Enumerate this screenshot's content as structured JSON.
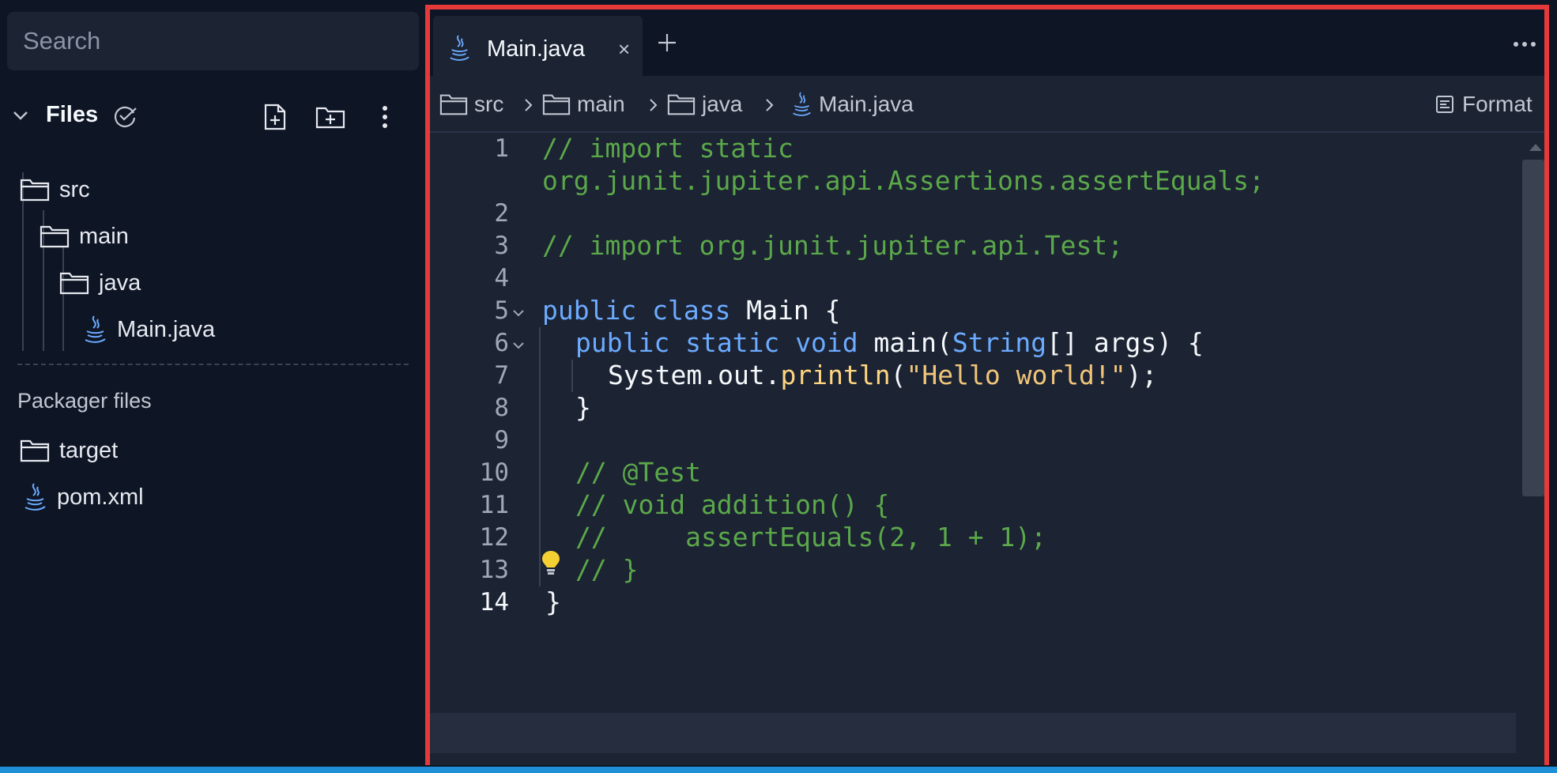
{
  "search": {
    "placeholder": "Search"
  },
  "files": {
    "title": "Files",
    "tree": [
      {
        "label": "src",
        "icon": "folder-icon"
      },
      {
        "label": "main",
        "icon": "folder-icon"
      },
      {
        "label": "java",
        "icon": "folder-icon"
      },
      {
        "label": "Main.java",
        "icon": "java-file-icon"
      }
    ]
  },
  "packager": {
    "title": "Packager files",
    "items": [
      {
        "label": "target",
        "icon": "folder-icon"
      },
      {
        "label": "pom.xml",
        "icon": "java-file-icon"
      }
    ]
  },
  "editor": {
    "tab": {
      "label": "Main.java",
      "close": "×"
    },
    "breadcrumb": [
      "src",
      "main",
      "java",
      "Main.java"
    ],
    "format_label": "Format",
    "line_numbers": [
      "1",
      "2",
      "3",
      "4",
      "5",
      "6",
      "7",
      "8",
      "9",
      "10",
      "11",
      "12",
      "13",
      "14"
    ],
    "active_line": "14",
    "code": {
      "l1a": "// import static",
      "l1b": "org.junit.jupiter.api.Assertions.assertEquals;",
      "l3": "// import org.junit.jupiter.api.Test;",
      "l5_kw1": "public",
      "l5_kw2": "class",
      "l5_rest": " Main {",
      "l6_kw1": "public",
      "l6_kw2": "static",
      "l6_kw3": "void",
      "l6_name": " main(",
      "l6_type": "String",
      "l6_rest": "[] args) {",
      "l7_obj": "System.out.",
      "l7_fn": "println",
      "l7_open": "(",
      "l7_str": "\"Hello world!\"",
      "l7_close": ");",
      "l8": "}",
      "l10": "// @Test",
      "l11": "// void addition() {",
      "l12": "//     assertEquals(2, 1 + 1);",
      "l13": "// }",
      "l14": "}"
    }
  },
  "colors": {
    "accent_border": "#e5393a",
    "comment": "#5ba84a",
    "keyword": "#6cabff",
    "string": "#f0c57a",
    "function": "#ffd680"
  }
}
